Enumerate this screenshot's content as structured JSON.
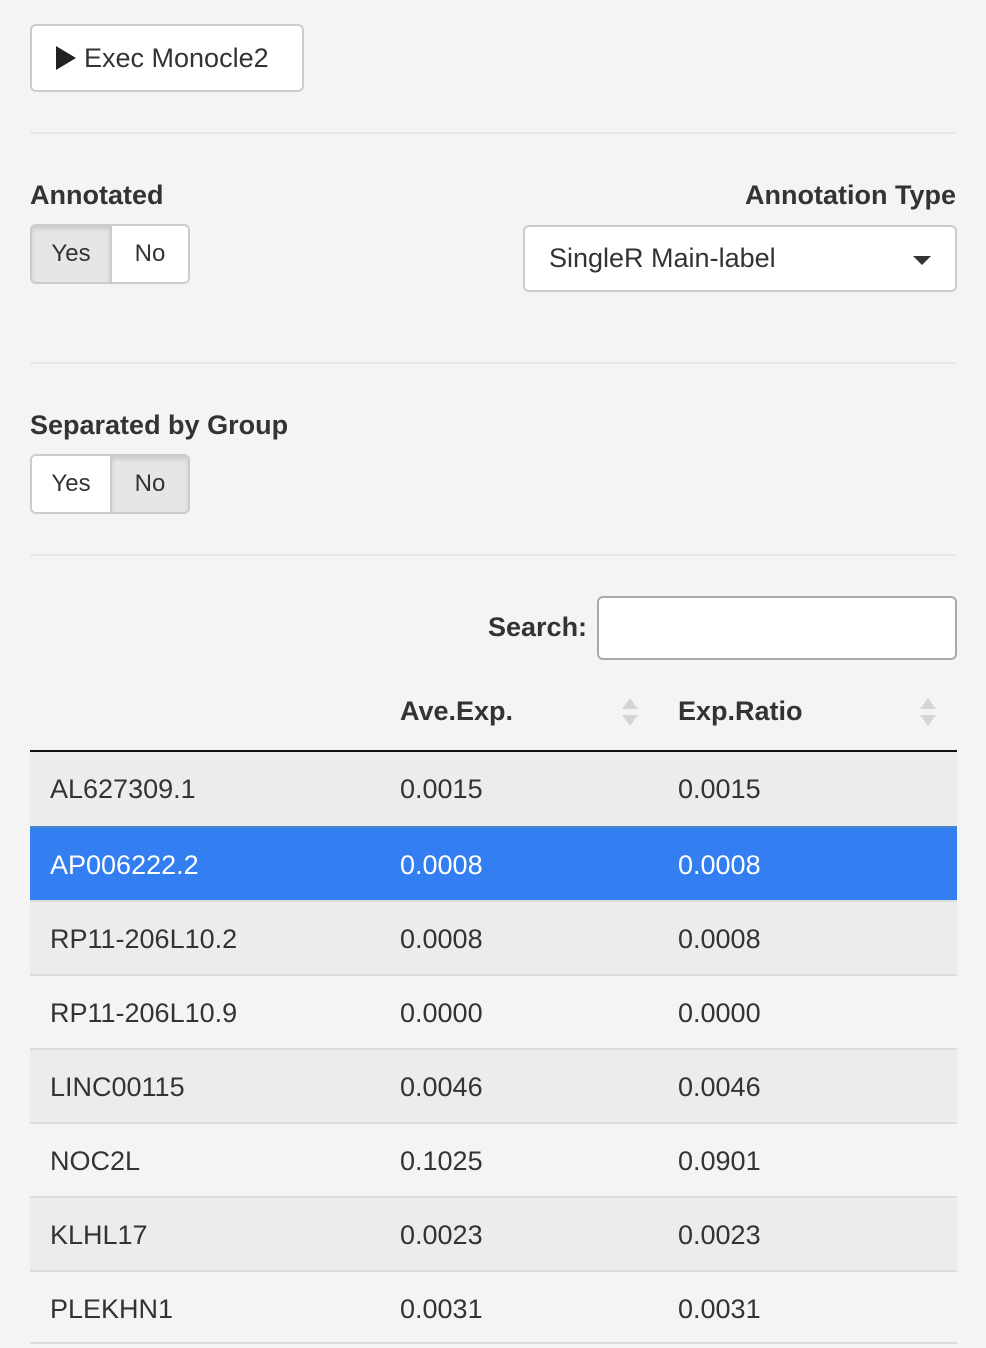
{
  "toolbar": {
    "exec_label": "Exec Monocle2"
  },
  "annotated": {
    "label": "Annotated",
    "options": [
      "Yes",
      "No"
    ],
    "selected": "Yes"
  },
  "annotation_type": {
    "label": "Annotation Type",
    "value": "SingleR Main-label"
  },
  "separated": {
    "label": "Separated by Group",
    "options": [
      "Yes",
      "No"
    ],
    "selected": "No"
  },
  "search": {
    "label": "Search:",
    "value": ""
  },
  "table": {
    "columns": [
      "",
      "Ave.Exp.",
      "Exp.Ratio"
    ],
    "rows": [
      [
        "AL627309.1",
        "0.0015",
        "0.0015"
      ],
      [
        "AP006222.2",
        "0.0008",
        "0.0008"
      ],
      [
        "RP11-206L10.2",
        "0.0008",
        "0.0008"
      ],
      [
        "RP11-206L10.9",
        "0.0000",
        "0.0000"
      ],
      [
        "LINC00115",
        "0.0046",
        "0.0046"
      ],
      [
        "NOC2L",
        "0.1025",
        "0.0901"
      ],
      [
        "KLHL17",
        "0.0023",
        "0.0023"
      ],
      [
        "PLEKHN1",
        "0.0031",
        "0.0031"
      ]
    ],
    "selected_row": "AP006222.2"
  },
  "colors": {
    "selected_row": "#337ef0",
    "background": "#f4f4f4"
  }
}
